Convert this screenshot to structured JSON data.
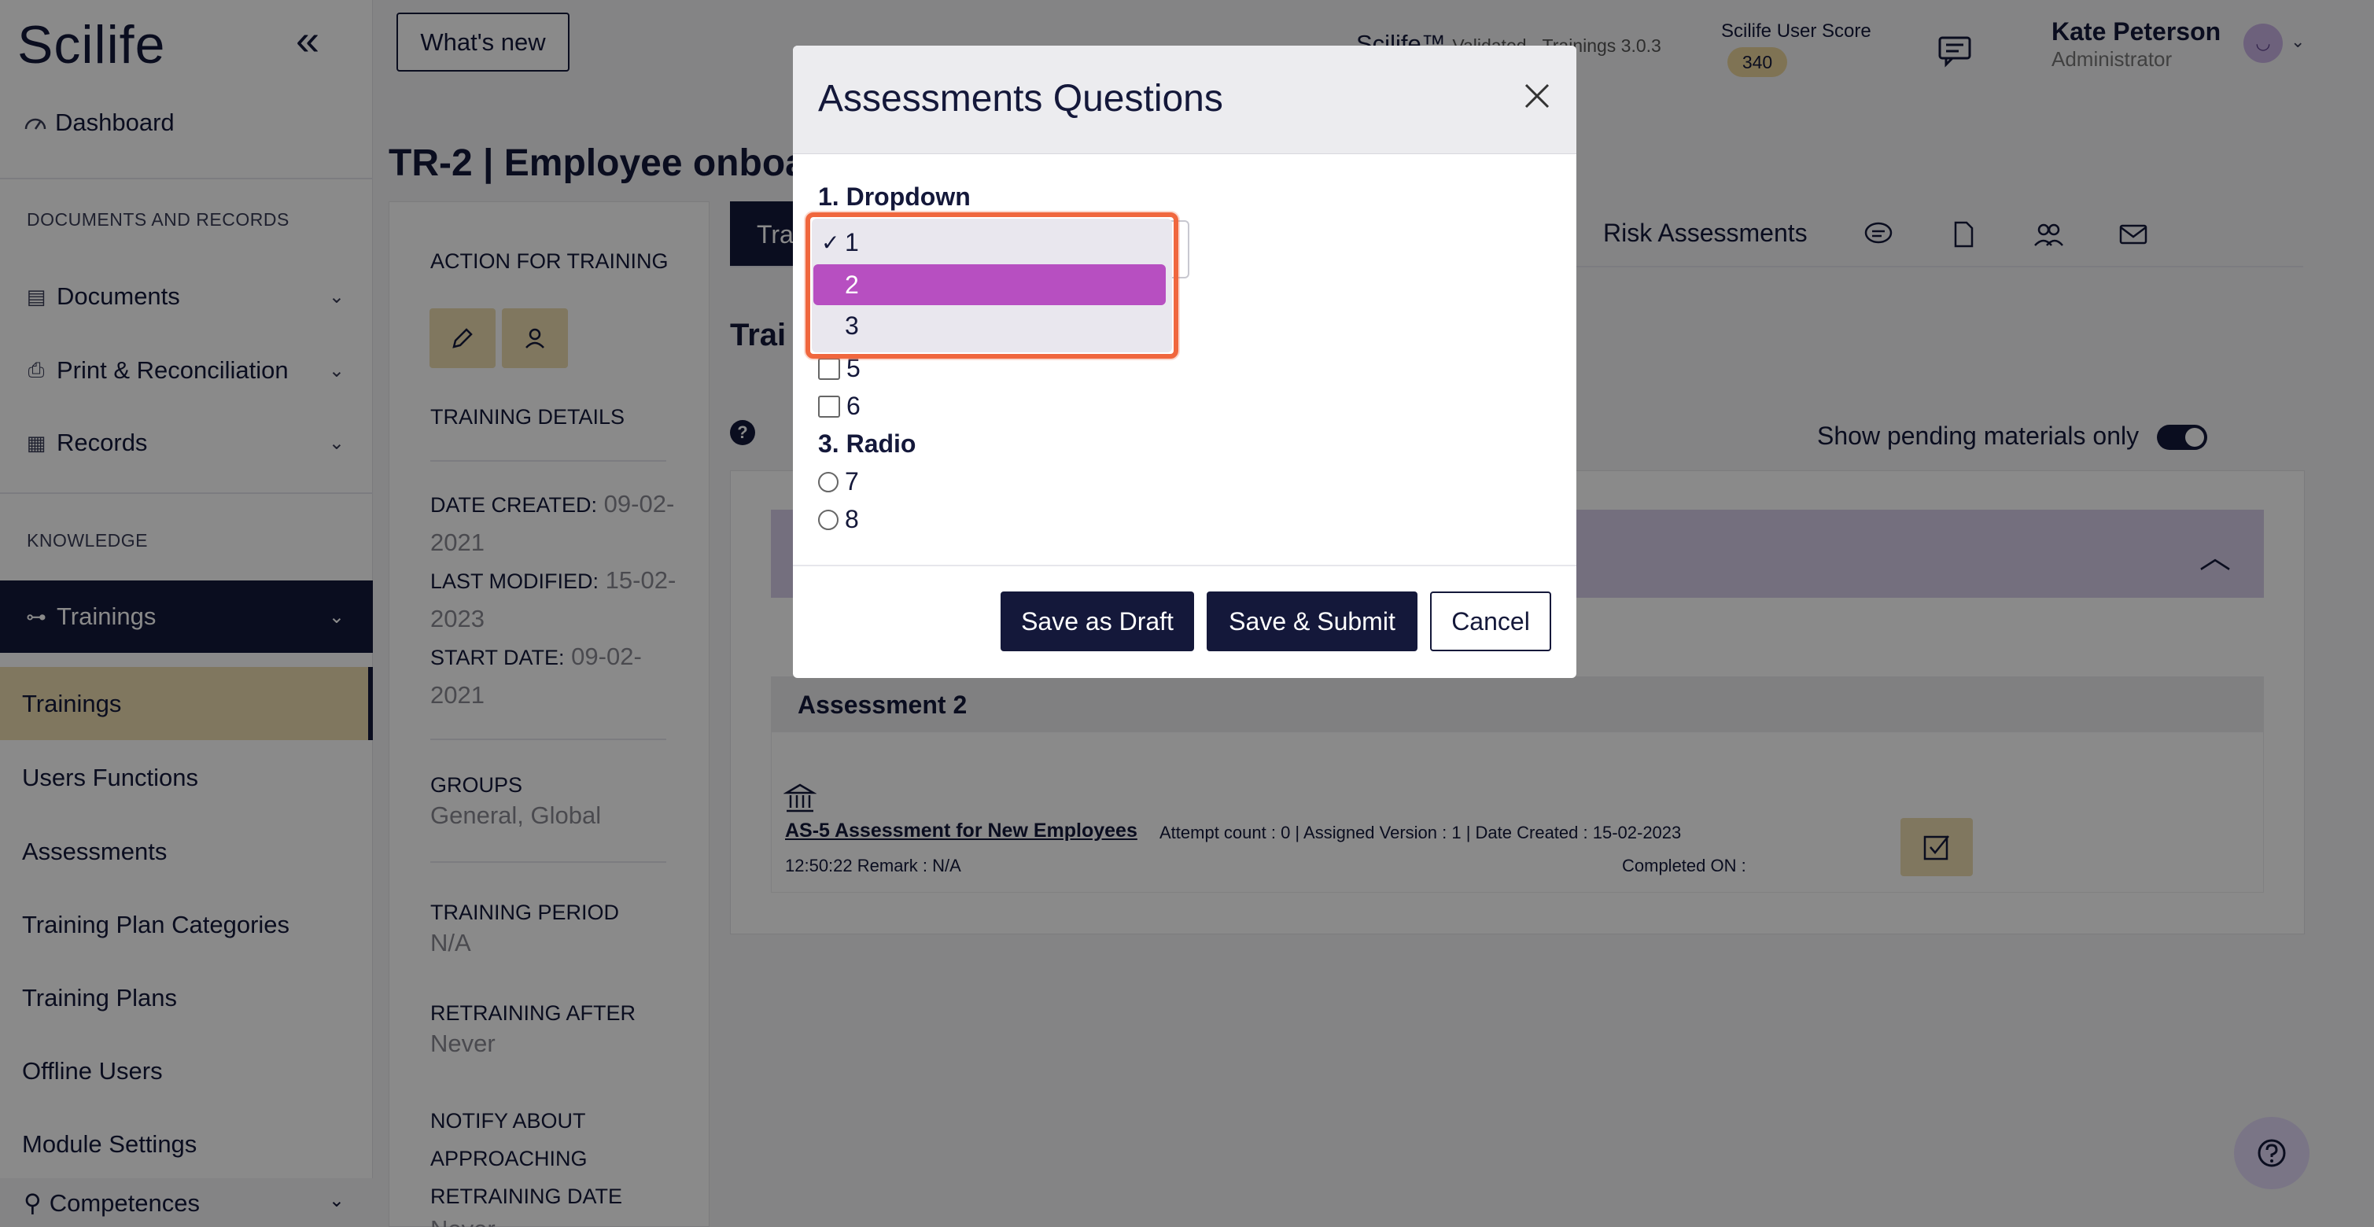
{
  "sidebar": {
    "logo": "Scilife",
    "dashboard": "Dashboard",
    "sections": [
      "DOCUMENTS AND RECORDS",
      "KNOWLEDGE"
    ],
    "groups": [
      {
        "label": "Documents"
      },
      {
        "label": "Print & Reconciliation"
      },
      {
        "label": "Records"
      },
      {
        "label": "Trainings"
      }
    ],
    "sub_items": [
      "Trainings",
      "Users Functions",
      "Assessments",
      "Training Plan Categories",
      "Training Plans",
      "Offline Users",
      "Module Settings"
    ],
    "competences": "Competences"
  },
  "header": {
    "whats_new": "What's new",
    "product": "Scilife™",
    "version_text": "Validated - Trainings 3.0.3",
    "score_label": "Scilife User Score",
    "score_value": "340",
    "user_name": "Kate Peterson",
    "user_role": "Administrator"
  },
  "page": {
    "title": "TR-2 | Employee onboa",
    "tab_active": "Trai",
    "tab_risk": "Risk Assessments",
    "section_heading": "Trai",
    "pending_label": "Show pending materials only",
    "left_panel": {
      "action_label": "ACTION FOR TRAINING",
      "details_label": "TRAINING DETAILS",
      "date_created_key": "DATE CREATED:",
      "date_created_val": "09-02-2021",
      "last_modified_key": "LAST MODIFIED:",
      "last_modified_val": "15-02-2023",
      "start_date_key": "START DATE:",
      "start_date_val": "09-02-2021",
      "groups_label": "GROUPS",
      "groups_val": "General, Global",
      "period_label": "TRAINING PERIOD",
      "period_val": "N/A",
      "retrain_label": "RETRAINING AFTER",
      "retrain_val": "Never",
      "notify_label": "NOTIFY ABOUT APPROACHING RETRAINING DATE",
      "notify_val": "Never"
    },
    "assessment": {
      "header": "Assessment 2",
      "link": "AS-5 Assessment for New Employees",
      "meta": "Attempt count : 0 | Assigned Version : 1 | Date Created : 15-02-2023",
      "meta2": "12:50:22 Remark : N/A",
      "completed": "Completed ON :"
    }
  },
  "modal": {
    "title": "Assessments Questions",
    "q1": "1. Dropdown",
    "dropdown_options": [
      "1",
      "2",
      "3"
    ],
    "dropdown_selected": "1",
    "dropdown_hover": "2",
    "q2_visible_options": [
      "5",
      "6"
    ],
    "q3": "3. Radio",
    "q3_options": [
      "7",
      "8"
    ],
    "save_draft": "Save as Draft",
    "save_submit": "Save & Submit",
    "cancel": "Cancel"
  },
  "colors": {
    "navy": "#14183a",
    "gold": "#ecdcaf",
    "hover_purple": "#b74fc1",
    "highlight_orange": "#f0673e"
  }
}
